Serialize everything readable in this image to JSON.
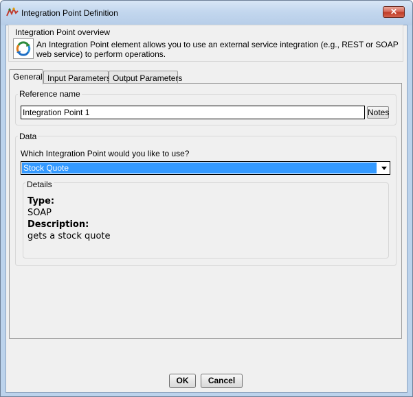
{
  "window": {
    "title": "Integration Point Definition",
    "close_glyph": "✕"
  },
  "overview": {
    "title": "Integration Point overview",
    "description": "An Integration Point element allows you to use an external service integration (e.g., REST or SOAP web service) to perform operations.",
    "icon": "integration-cycle-icon"
  },
  "tabs": [
    {
      "label": "General",
      "active": true
    },
    {
      "label": "Input Parameters",
      "active": false
    },
    {
      "label": "Output Parameters",
      "active": false
    }
  ],
  "reference": {
    "group_label": "Reference name",
    "value": "Integration Point 1",
    "notes_label": "Notes"
  },
  "data_section": {
    "group_label": "Data",
    "question": "Which Integration Point would you like to use?",
    "selected": "Stock Quote",
    "details_label": "Details",
    "type_label": "Type:",
    "type_value": "SOAP",
    "description_label": "Description:",
    "description_value": "gets a stock quote"
  },
  "buttons": {
    "ok": "OK",
    "cancel": "Cancel"
  },
  "colors": {
    "selection": "#3399ff",
    "title_bar": "#c3d7ee",
    "close_button": "#c03c27"
  }
}
